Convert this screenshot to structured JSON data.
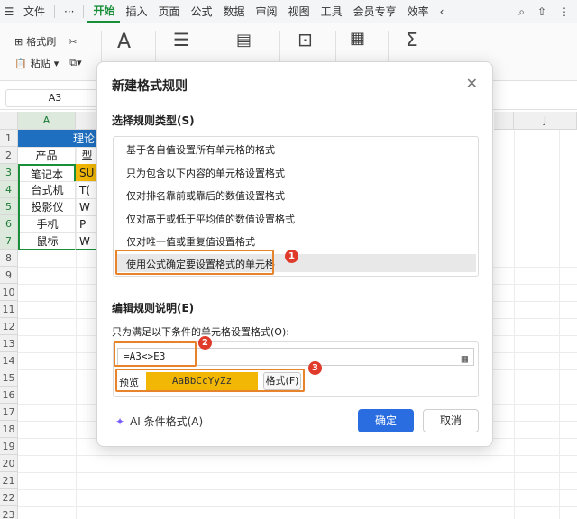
{
  "menubar": {
    "file": "文件",
    "more": "···",
    "tabs": [
      "开始",
      "插入",
      "页面",
      "公式",
      "数据",
      "审阅",
      "视图",
      "工具",
      "会员专享",
      "效率"
    ],
    "overflow": "‹"
  },
  "ribbon": {
    "format_painter": "格式刷",
    "paste": "粘贴"
  },
  "formula_bar": {
    "namebox": "A3"
  },
  "sheet": {
    "columns": [
      "A",
      "J"
    ],
    "rows": [
      "1",
      "2",
      "3",
      "4",
      "5",
      "6",
      "7",
      "8",
      "9",
      "10",
      "11",
      "12",
      "13",
      "14",
      "15",
      "16",
      "17",
      "18",
      "19",
      "20",
      "21",
      "22",
      "23"
    ],
    "title_cell": "理论",
    "header": [
      "产品",
      "型"
    ],
    "data": [
      [
        "笔记本",
        "SU"
      ],
      [
        "台式机",
        "T("
      ],
      [
        "投影仪",
        "W"
      ],
      [
        "手机",
        "P"
      ],
      [
        "鼠标",
        "W"
      ]
    ]
  },
  "dialog": {
    "title": "新建格式规则",
    "section1": "选择规则类型(S)",
    "rules": [
      "基于各自值设置所有单元格的格式",
      "只为包含以下内容的单元格设置格式",
      "仅对排名靠前或靠后的数值设置格式",
      "仅对高于或低于平均值的数值设置格式",
      "仅对唯一值或重复值设置格式",
      "使用公式确定要设置格式的单元格"
    ],
    "section2": "编辑规则说明(E)",
    "condition_label": "只为满足以下条件的单元格设置格式(O):",
    "formula_value": "=A3<>E3",
    "preview_label": "预览",
    "preview_sample": "AaBbCcYyZz",
    "format_button": "格式(F)",
    "ai_button": "AI 条件格式(A)",
    "ok": "确定",
    "cancel": "取消",
    "badges": [
      "1",
      "2",
      "3"
    ]
  },
  "colors": {
    "accent_green": "#1a8f3a",
    "header_blue": "#1f6fc0",
    "highlight_yellow": "#f2b705",
    "ok_blue": "#2a6de0",
    "annotation_orange": "#e7832b",
    "badge_red": "#e03a2a"
  }
}
